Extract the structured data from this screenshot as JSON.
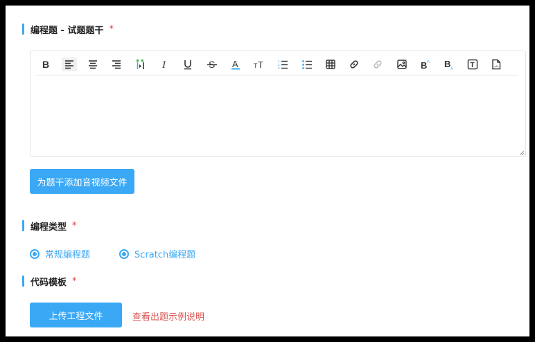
{
  "sections": {
    "stem_title": "编程题 - 试题题干",
    "type_title": "编程类型",
    "template_title": "代码模板",
    "required_mark": "*"
  },
  "toolbar": {
    "items": [
      {
        "name": "bold-icon",
        "label": "B"
      },
      {
        "name": "align-left-icon",
        "label": "align-left"
      },
      {
        "name": "align-center-icon",
        "label": "align-center"
      },
      {
        "name": "align-right-icon",
        "label": "align-right"
      },
      {
        "name": "line-height-icon",
        "label": "line-height"
      },
      {
        "name": "italic-icon",
        "label": "I"
      },
      {
        "name": "underline-icon",
        "label": "U"
      },
      {
        "name": "strikethrough-icon",
        "label": "S"
      },
      {
        "name": "font-color-icon",
        "label": "A"
      },
      {
        "name": "font-size-icon",
        "label": "TT"
      },
      {
        "name": "ordered-list-icon",
        "label": "ol"
      },
      {
        "name": "unordered-list-icon",
        "label": "ul"
      },
      {
        "name": "table-icon",
        "label": "table"
      },
      {
        "name": "link-icon",
        "label": "link"
      },
      {
        "name": "unlink-icon",
        "label": "unlink"
      },
      {
        "name": "image-icon",
        "label": "image"
      },
      {
        "name": "superscript-icon",
        "label": "B"
      },
      {
        "name": "subscript-icon",
        "label": "B"
      },
      {
        "name": "text-box-icon",
        "label": "T"
      },
      {
        "name": "file-icon",
        "label": "file"
      }
    ]
  },
  "buttons": {
    "add_media": "为题干添加音视频文件",
    "upload_project": "上传工程文件"
  },
  "radio_options": [
    {
      "label": "常规编程题",
      "checked": true
    },
    {
      "label": "Scratch编程题",
      "checked": true
    }
  ],
  "help_link": "查看出题示例说明",
  "colors": {
    "accent": "#3aa8f5",
    "required": "#e23a3a",
    "link": "#d9534f"
  }
}
